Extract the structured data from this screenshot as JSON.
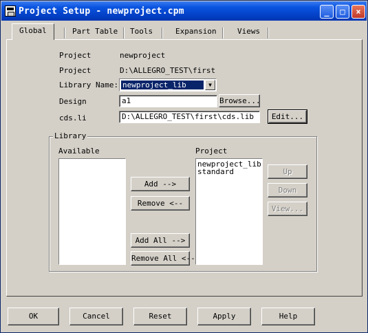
{
  "window": {
    "title": "Project Setup - newproject.cpm",
    "buttons": {
      "minimize": "_",
      "maximize": "□",
      "close": "×"
    }
  },
  "tabs": [
    {
      "label": "Global"
    },
    {
      "label": "Part Table"
    },
    {
      "label": "Tools"
    },
    {
      "label": "Expansion"
    },
    {
      "label": "Views"
    }
  ],
  "global": {
    "project_name_label": "Project",
    "project_name_value": "newproject",
    "project_dir_label": "Project",
    "project_dir_value": "D:\\ALLEGRO_TEST\\first",
    "library_name_label": "Library Name:",
    "library_name_value": "newproject_lib",
    "design_label": "Design",
    "design_value": "a1",
    "browse_label": "Browse...",
    "cdslib_label": "cds.li",
    "cdslib_value": "D:\\ALLEGRO_TEST\\first\\cds.lib",
    "edit_label": "Edit..."
  },
  "library": {
    "group_label": "Library",
    "available_label": "Available",
    "available_items": [],
    "project_label": "Project",
    "project_items": [
      "newproject_lib",
      "standard"
    ],
    "add_label": "Add -->",
    "remove_label": "Remove <--",
    "add_all_label": "Add All -->",
    "remove_all_label": "Remove All <--",
    "up_label": "Up",
    "down_label": "Down",
    "view_label": "View..."
  },
  "footer": {
    "ok": "OK",
    "cancel": "Cancel",
    "reset": "Reset",
    "apply": "Apply",
    "help": "Help"
  }
}
